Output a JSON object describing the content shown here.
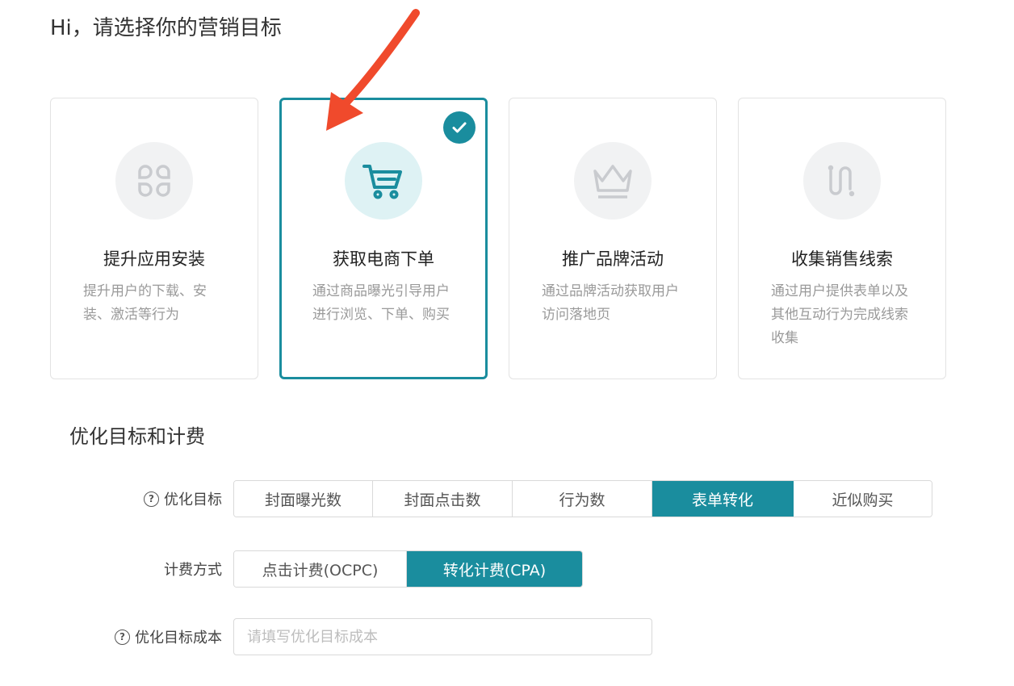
{
  "page": {
    "title": "Hi，请选择你的营销目标"
  },
  "goals": [
    {
      "title": "提升应用安装",
      "desc": "提升用户的下载、安装、激活等行为",
      "icon": "app-grid-icon",
      "selected": false
    },
    {
      "title": "获取电商下单",
      "desc": "通过商品曝光引导用户进行浏览、下单、购买",
      "icon": "shopping-cart-icon",
      "selected": true
    },
    {
      "title": "推广品牌活动",
      "desc": "通过品牌活动获取用户访问落地页",
      "icon": "crown-icon",
      "selected": false
    },
    {
      "title": "收集销售线索",
      "desc": "通过用户提供表单以及其他互动行为完成线索收集",
      "icon": "lead-path-icon",
      "selected": false
    }
  ],
  "optimize": {
    "section_title": "优化目标和计费",
    "target_label": "优化目标",
    "target_options": [
      "封面曝光数",
      "封面点击数",
      "行为数",
      "表单转化",
      "近似购买"
    ],
    "target_selected": "表单转化",
    "billing_label": "计费方式",
    "billing_options": [
      "点击计费(OCPC)",
      "转化计费(CPA)"
    ],
    "billing_selected": "转化计费(CPA)",
    "cost_label": "优化目标成本",
    "cost_placeholder": "请填写优化目标成本",
    "cost_value": ""
  },
  "colors": {
    "accent": "#1a8d9e",
    "arrow": "#f04a2c"
  }
}
